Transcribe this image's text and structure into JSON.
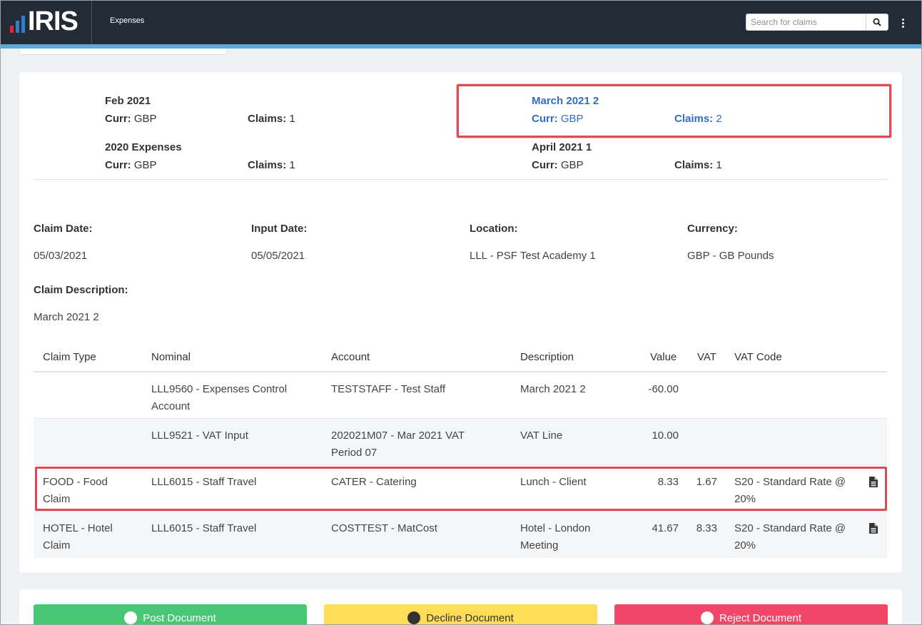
{
  "header": {
    "logo_text": "IRIS",
    "app_title": "Expenses",
    "search_placeholder": "Search for claims"
  },
  "colors": {
    "header_bg": "#222b36",
    "accent_bar": "#5aaad9",
    "active_link": "#2f6fc9",
    "highlight_border": "#e04a52",
    "post_button": "#48c774",
    "decline_button": "#ffdd57",
    "reject_button": "#f14668"
  },
  "periods": [
    {
      "name": "Feb 2021",
      "curr_label": "Curr:",
      "curr": "GBP",
      "claims_label": "Claims:",
      "claims": "1",
      "active": false
    },
    {
      "name": "March 2021 2",
      "curr_label": "Curr:",
      "curr": "GBP",
      "claims_label": "Claims:",
      "claims": "2",
      "active": true
    },
    {
      "name": "2020 Expenses",
      "curr_label": "Curr:",
      "curr": "GBP",
      "claims_label": "Claims:",
      "claims": "1",
      "active": false
    },
    {
      "name": "April 2021 1",
      "curr_label": "Curr:",
      "curr": "GBP",
      "claims_label": "Claims:",
      "claims": "1",
      "active": false
    }
  ],
  "claim": {
    "claim_date_label": "Claim Date:",
    "claim_date": "05/03/2021",
    "input_date_label": "Input Date:",
    "input_date": "05/05/2021",
    "location_label": "Location:",
    "location": "LLL - PSF Test Academy 1",
    "currency_label": "Currency:",
    "currency": "GBP - GB Pounds",
    "description_label": "Claim Description:",
    "description": "March 2021 2"
  },
  "table": {
    "headers": [
      "Claim Type",
      "Nominal",
      "Account",
      "Description",
      "Value",
      "VAT",
      "VAT Code"
    ],
    "rows": [
      {
        "claim_type": "",
        "nominal": "LLL9560 - Expenses Control Account",
        "account": "TESTSTAFF - Test Staff",
        "description": "March 2021 2",
        "value": "-60.00",
        "vat": "",
        "vat_code": "",
        "doc_icon": ""
      },
      {
        "claim_type": "",
        "nominal": "LLL9521 - VAT Input",
        "account": "202021M07 - Mar 2021 VAT Period 07",
        "description": "VAT Line",
        "value": "10.00",
        "vat": "",
        "vat_code": "",
        "doc_icon": ""
      },
      {
        "claim_type": "FOOD - Food Claim",
        "nominal": "LLL6015 - Staff Travel",
        "account": "CATER - Catering",
        "description": "Lunch - Client",
        "value": "8.33",
        "vat": "1.67",
        "vat_code": "S20 - Standard Rate @ 20%",
        "doc_icon": "document-icon"
      },
      {
        "claim_type": "HOTEL - Hotel Claim",
        "nominal": "LLL6015 - Staff Travel",
        "account": "COSTTEST - MatCost",
        "description": "Hotel - London Meeting",
        "value": "41.67",
        "vat": "8.33",
        "vat_code": "S20 - Standard Rate @ 20%",
        "doc_icon": "document-icon"
      }
    ]
  },
  "actions": {
    "post_label": "Post Document",
    "decline_label": "Decline Document",
    "reject_label": "Reject Document"
  }
}
